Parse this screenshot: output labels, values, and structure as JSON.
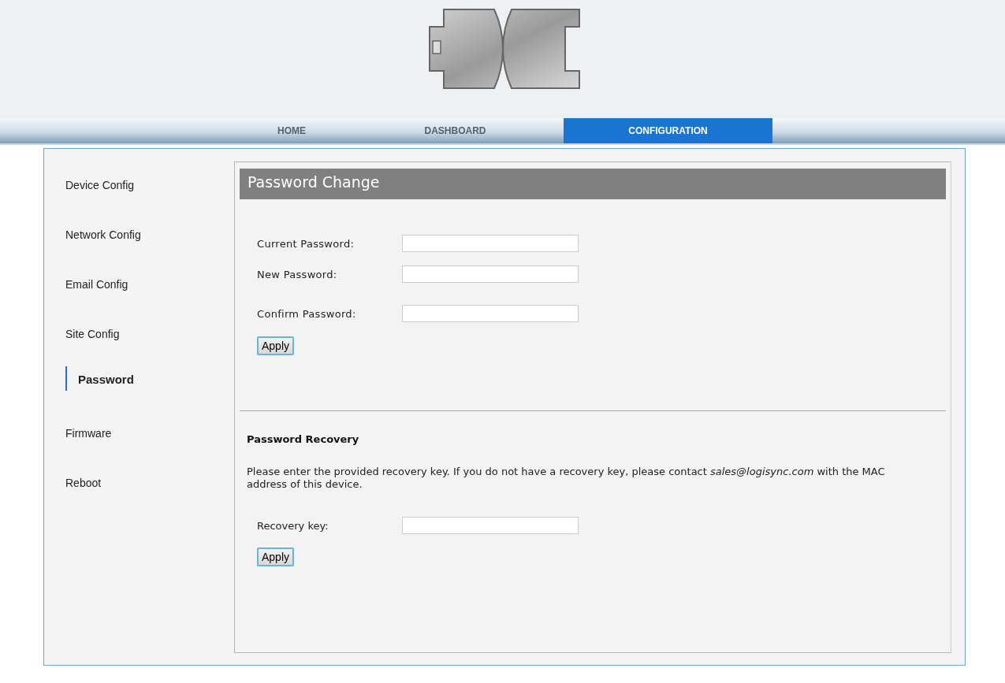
{
  "nav": {
    "tabs": [
      {
        "label": "HOME",
        "selected": false
      },
      {
        "label": "DASHBOARD",
        "selected": false
      },
      {
        "label": "CONFIGURATION",
        "selected": true
      }
    ]
  },
  "sidebar": {
    "items": [
      {
        "label": "Device Config",
        "selected": false
      },
      {
        "label": "Network Config",
        "selected": false
      },
      {
        "label": "Email Config",
        "selected": false
      },
      {
        "label": "Site Config",
        "selected": false
      },
      {
        "label": "Password",
        "selected": true
      },
      {
        "label": "Firmware",
        "selected": false
      },
      {
        "label": "Reboot",
        "selected": false
      }
    ]
  },
  "panel": {
    "title": "Password Change",
    "fields": [
      {
        "label": "Current Password:"
      },
      {
        "label": "New Password:"
      },
      {
        "label": "Confirm Password:"
      }
    ],
    "apply_button": "Apply",
    "recovery": {
      "heading": "Password Recovery",
      "text": "Please enter the provided recovery key. If you do not have a recovery key, please contact *sales@logisync.com* with the MAC address of this device.",
      "fields": [
        {
          "label": "Recovery key:"
        }
      ],
      "apply_button": "Apply"
    }
  }
}
